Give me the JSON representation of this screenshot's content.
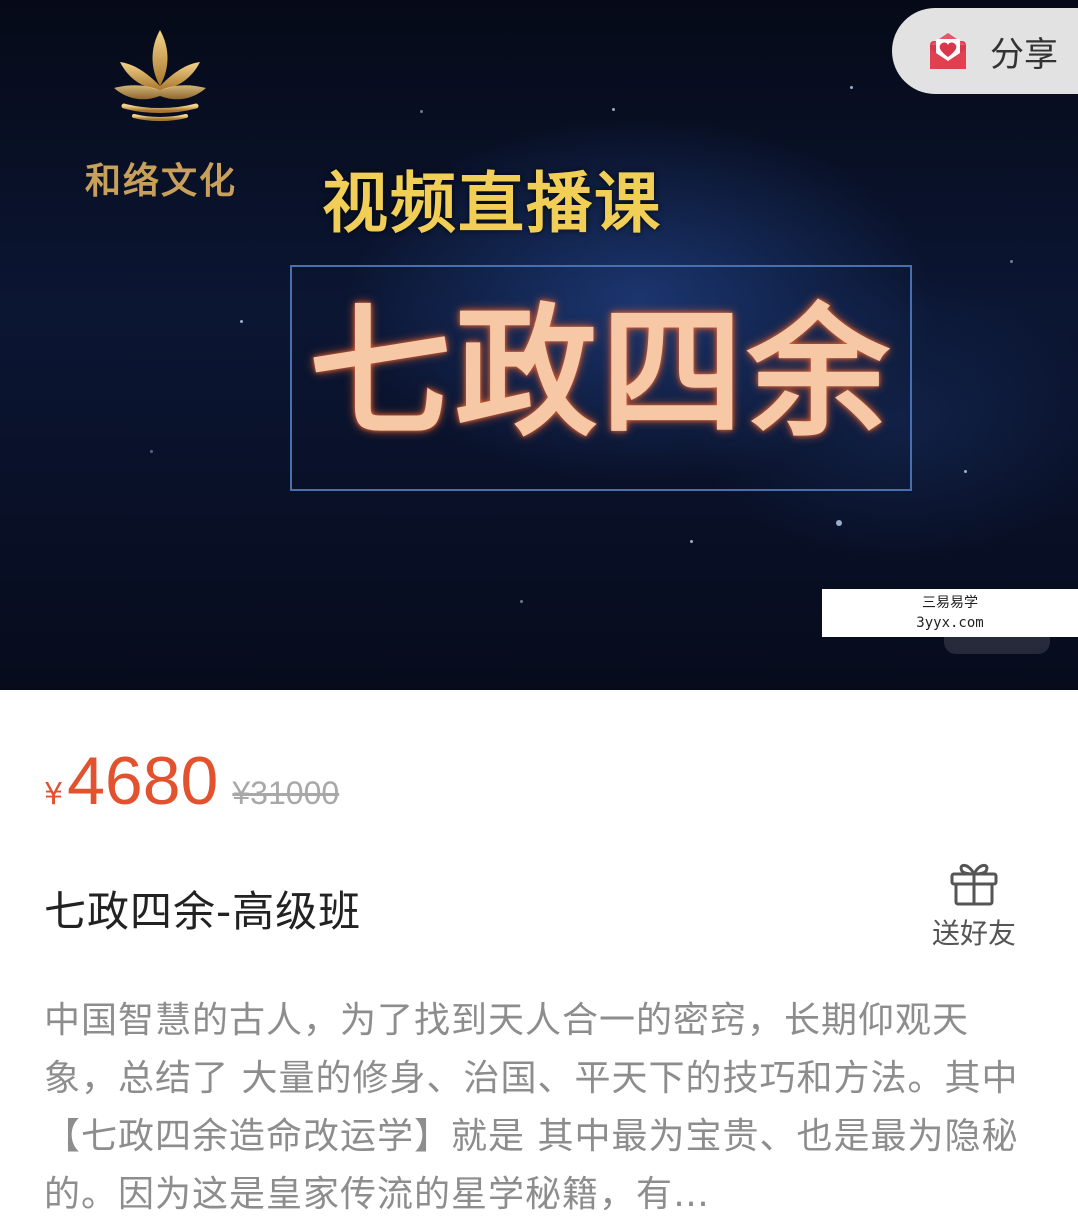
{
  "banner": {
    "brand_logo_text": "和络文化",
    "live_label": "视频直播课",
    "course_big_title": "七政四余",
    "colors": {
      "live_label": "#f1cf57",
      "course_big_title": "#f6c8a6",
      "box_border": "#4a6fb0"
    }
  },
  "share": {
    "label": "分享",
    "icon": "heart-envelope-icon"
  },
  "watermark": {
    "line1": "三易易学",
    "line2": "3yyx.com"
  },
  "price": {
    "symbol": "¥",
    "current": "4680",
    "original": "¥31000",
    "color": "#e2522f"
  },
  "course": {
    "title": "七政四余-高级班"
  },
  "gift": {
    "label": "送好友",
    "icon": "gift-icon"
  },
  "description": "中国智慧的古人，为了找到天人合一的密窍，长期仰观天象，总结了 大量的修身、治国、平天下的技巧和方法。其中【七政四余造命改运学】就是 其中最为宝贵、也是最为隐秘的。因为这是皇家传流的星学秘籍，有…"
}
